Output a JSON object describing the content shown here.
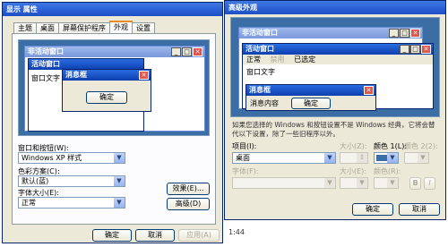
{
  "left": {
    "title": "显示 属性",
    "tabs": [
      {
        "label": "主题"
      },
      {
        "label": "桌面"
      },
      {
        "label": "屏幕保护程序"
      },
      {
        "label": "外观"
      },
      {
        "label": "设置"
      }
    ],
    "preview": {
      "inactive_title": "非活动窗口",
      "active_title": "活动窗口",
      "window_text": "窗口文字",
      "msgbox_title": "消息框",
      "ok": "确定"
    },
    "style_label": "窗口和按钮(W):",
    "style_value": "Windows XP 样式",
    "scheme_label": "色彩方案(C):",
    "scheme_value": "默认(蓝)",
    "fontsize_label": "字体大小(E):",
    "fontsize_value": "正常",
    "effects_button": "效果(E)...",
    "advanced_button": "高级(D)",
    "ok": "确定",
    "cancel": "取消",
    "apply": "应用(A)"
  },
  "right": {
    "title": "高级外观",
    "preview": {
      "inactive_title": "非活动窗口",
      "active_title": "活动窗口",
      "menu": [
        "正常",
        "禁用",
        "已选定"
      ],
      "window_text": "窗口文字",
      "msgbox_title": "消息框",
      "msg_text": "消息内容",
      "ok": "确定"
    },
    "description": "如果您选择的 Windows 和按钮设置不是 Windows 经典，它将会替代以下设置，除了一些旧程序以外。",
    "item_label": "项目(I):",
    "item_value": "桌面",
    "size_label": "大小(Z):",
    "color1_label": "颜色 1(L):",
    "color2_label": "颜色 2(2):",
    "font_label": "字体(F):",
    "font_size_label": "大小(E):",
    "font_color_label": "颜色(R):",
    "bold": "B",
    "italic": "I",
    "ok": "确定",
    "cancel": "取消",
    "accent": "#0a246a"
  },
  "desktop": {
    "clock": "1:44"
  }
}
